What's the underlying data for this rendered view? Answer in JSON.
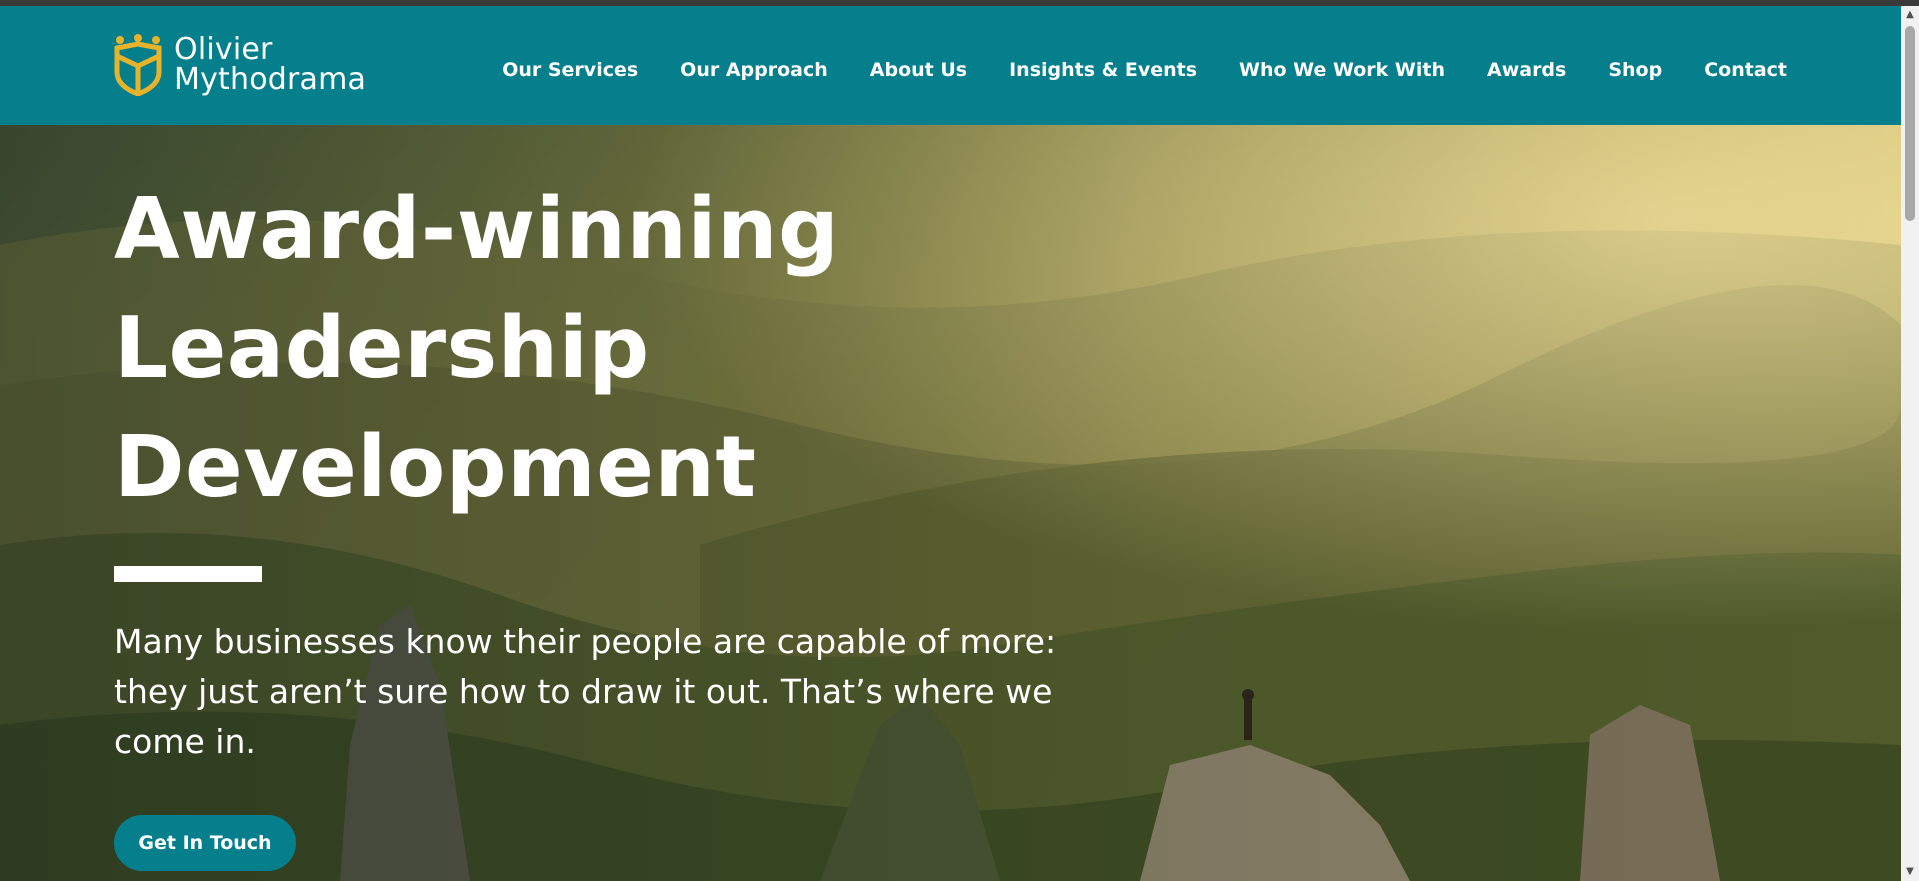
{
  "header": {
    "logo": {
      "line1": "Olivier",
      "line2": "Mythodrama",
      "icon": "crown-shield-icon"
    },
    "nav": [
      {
        "label": "Our Services"
      },
      {
        "label": "Our Approach"
      },
      {
        "label": "About Us"
      },
      {
        "label": "Insights & Events"
      },
      {
        "label": "Who We Work With"
      },
      {
        "label": "Awards"
      },
      {
        "label": "Shop"
      },
      {
        "label": "Contact"
      }
    ]
  },
  "hero": {
    "title_lines": [
      "Award-winning",
      "Leadership",
      "Development"
    ],
    "subtitle": "Many businesses know their people are capable of more: they just aren’t sure how to draw it out. That’s where we come in.",
    "cta_label": "Get In Touch",
    "background": "mountain-landscape-with-hiker"
  },
  "colors": {
    "brand_teal": "#067f8c",
    "logo_gold": "#e7b32b",
    "text_white": "#ffffff"
  },
  "scrollbar": {
    "up_icon": "arrow-up-icon",
    "down_icon": "arrow-down-icon"
  }
}
